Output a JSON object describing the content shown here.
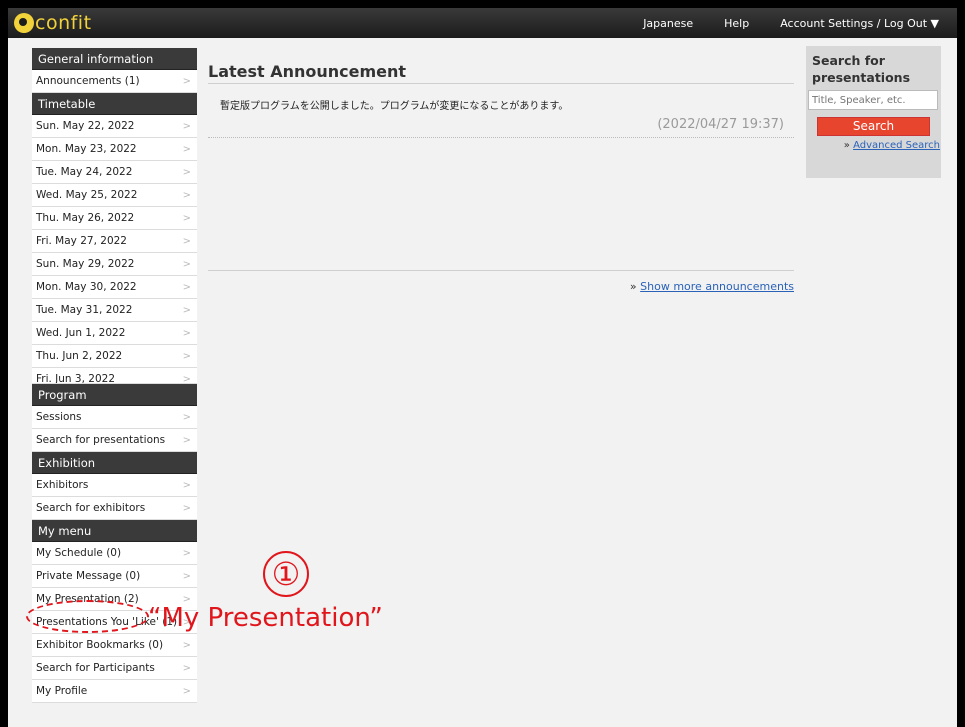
{
  "header": {
    "logo_text": "confit",
    "links": [
      "Japanese",
      "Help",
      "Account Settings / Log Out ▼"
    ]
  },
  "sidebar": {
    "sections": [
      {
        "title": "General information",
        "items": [
          "Announcements (1)"
        ]
      },
      {
        "title": "Timetable",
        "items": [
          "Sun. May 22, 2022",
          "Mon. May 23, 2022",
          "Tue. May 24, 2022",
          "Wed. May 25, 2022",
          "Thu. May 26, 2022",
          "Fri. May 27, 2022",
          "Sun. May 29, 2022",
          "Mon. May 30, 2022",
          "Tue. May 31, 2022",
          "Wed. Jun 1, 2022",
          "Thu. Jun 2, 2022",
          "Fri. Jun 3, 2022"
        ]
      },
      {
        "title": "Program",
        "items": [
          "Sessions",
          "Search for presentations"
        ]
      },
      {
        "title": "Exhibition",
        "items": [
          "Exhibitors",
          "Search for exhibitors"
        ]
      },
      {
        "title": "My menu",
        "items": [
          "My Schedule (0)",
          "Private Message (0)",
          "My Presentation (2)",
          "Presentations You 'Like' (1)",
          "Exhibitor Bookmarks (0)",
          "Search for Participants",
          "My Profile"
        ]
      }
    ],
    "chevron": ">"
  },
  "main": {
    "title": "Latest Announcement",
    "announcement_text": "暫定版プログラムを公開しました。プログラムが変更になることがあります。",
    "announcement_date": "(2022/04/27 19:37)",
    "more_prefix": "» ",
    "more_link": "Show more announcements"
  },
  "search": {
    "title": "Search for presentations",
    "placeholder": "Title, Speaker, etc.",
    "button": "Search",
    "advanced_prefix": "» ",
    "advanced_link": "Advanced Search"
  },
  "overlay": {
    "number": "①",
    "label": "“My Presentation”",
    "accent_color": "#e0161c"
  }
}
